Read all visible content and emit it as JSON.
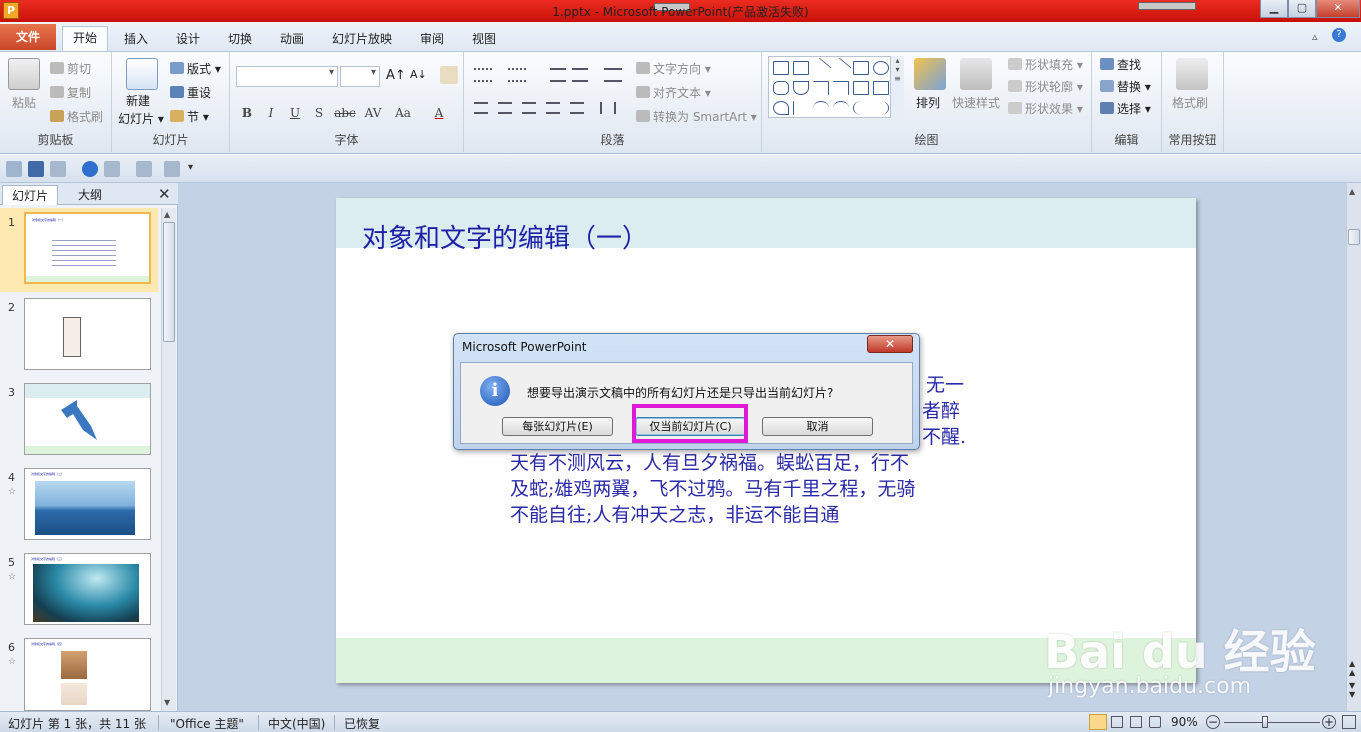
{
  "window": {
    "title": "1.pptx - Microsoft PowerPoint(产品激活失败)",
    "min": "▁",
    "max": "▢",
    "close": "✕"
  },
  "tabs": [
    "文件",
    "开始",
    "插入",
    "设计",
    "切换",
    "动画",
    "幻灯片放映",
    "审阅",
    "视图"
  ],
  "ribbon": {
    "clipboard": {
      "label": "剪贴板",
      "paste": "粘贴",
      "cut": "剪切",
      "copy": "复制",
      "format_painter": "格式刷"
    },
    "slides": {
      "label": "幻灯片",
      "new_slide_line1": "新建",
      "new_slide_line2": "幻灯片 ▾",
      "layout": "版式 ▾",
      "reset": "重设",
      "section": "节 ▾"
    },
    "font": {
      "label": "字体",
      "bold": "B",
      "italic": "I",
      "underline": "U",
      "shadow": "S",
      "strike": "abc",
      "spacing": "AV",
      "case": "Aa",
      "color": "A",
      "grow": "A↑",
      "shrink": "A↓"
    },
    "paragraph": {
      "label": "段落",
      "text_direction": "文字方向 ▾",
      "align_text": "对齐文本 ▾",
      "smartart": "转换为 SmartArt ▾"
    },
    "drawing": {
      "label": "绘图",
      "arrange": "排列",
      "quick_styles": "快速样式",
      "fill": "形状填充 ▾",
      "outline": "形状轮廓 ▾",
      "effects": "形状效果 ▾"
    },
    "editing": {
      "label": "编辑",
      "find": "查找",
      "replace": "替换 ▾",
      "select": "选择 ▾"
    },
    "common": {
      "label": "常用按钮",
      "format_painter": "格式刷"
    }
  },
  "panel": {
    "tab_slides": "幻灯片",
    "tab_outline": "大纲",
    "close": "✕",
    "thumbs": [
      {
        "num": "1",
        "star": "",
        "title": "对象和文字的编辑（一）"
      },
      {
        "num": "2",
        "star": "",
        "title": ""
      },
      {
        "num": "3",
        "star": "",
        "title": ""
      },
      {
        "num": "4",
        "star": "☆",
        "title": "对象和文字的编辑（二）"
      },
      {
        "num": "5",
        "star": "☆",
        "title": "对象和文字的编辑（三）"
      },
      {
        "num": "6",
        "star": "☆",
        "title": "对象和文字的编辑（四）"
      }
    ]
  },
  "slide": {
    "title": "对象和文字的编辑（一）",
    "body_lines": [
      "无一",
      "者醉",
      "不醒.",
      "天有不测风云，人有旦夕祸福。蜈蚣百足，行不",
      "及蛇;雄鸡两翼，飞不过鸦。马有千里之程，无骑",
      "不能自往;人有冲天之志，非运不能自通"
    ]
  },
  "dialog": {
    "title": "Microsoft PowerPoint",
    "close": "✕",
    "icon": "i",
    "message": "想要导出演示文稿中的所有幻灯片还是只导出当前幻灯片?",
    "btn_all": "每张幻灯片(E)",
    "btn_current": "仅当前幻灯片(C)",
    "btn_cancel": "取消"
  },
  "status": {
    "slide_info": "幻灯片 第 1 张，共 11 张",
    "theme": "\"Office 主题\"",
    "language": "中文(中国)",
    "recovered": "已恢复",
    "zoom": "90%"
  },
  "watermark": {
    "logo": "Bai du 经验",
    "url": "jingyan.baidu.com"
  },
  "colors": {
    "accent_highlight": "#e019d6",
    "slide_title": "#1f22a6",
    "titlebar": "#d81e14"
  }
}
